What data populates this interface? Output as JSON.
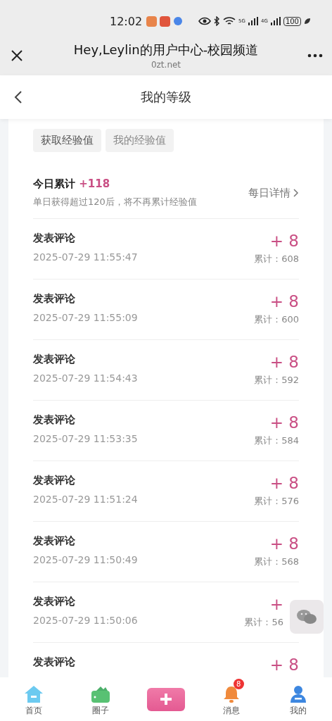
{
  "status_bar": {
    "time": "12:02",
    "network_1": "5G",
    "network_2": "4G",
    "battery": "100"
  },
  "browser": {
    "title": "Hey,Leylin的用户中心-校园频道",
    "domain": "0zt.net"
  },
  "page": {
    "title": "我的等级"
  },
  "tabs": [
    {
      "label": "获取经验值",
      "selected": true
    },
    {
      "label": "我的经验值",
      "selected": false
    }
  ],
  "today": {
    "label": "今日累计",
    "value": "+118",
    "note": "单日获得超过120后，将不再累计经验值",
    "link": "每日详情"
  },
  "records": [
    {
      "title": "发表评论",
      "time": "2025-07-29 11:55:47",
      "amount": "+ 8",
      "total": "累计：608"
    },
    {
      "title": "发表评论",
      "time": "2025-07-29 11:55:09",
      "amount": "+ 8",
      "total": "累计：600"
    },
    {
      "title": "发表评论",
      "time": "2025-07-29 11:54:43",
      "amount": "+ 8",
      "total": "累计：592"
    },
    {
      "title": "发表评论",
      "time": "2025-07-29 11:53:35",
      "amount": "+ 8",
      "total": "累计：584"
    },
    {
      "title": "发表评论",
      "time": "2025-07-29 11:51:24",
      "amount": "+ 8",
      "total": "累计：576"
    },
    {
      "title": "发表评论",
      "time": "2025-07-29 11:50:49",
      "amount": "+ 8",
      "total": "累计：568"
    },
    {
      "title": "发表评论",
      "time": "2025-07-29 11:50:06",
      "amount": "+",
      "total": "累计：56",
      "covered": true
    },
    {
      "title": "发表评论",
      "amount": "+ 8"
    }
  ],
  "nav": [
    {
      "kind": "home",
      "label": "首页"
    },
    {
      "kind": "circle",
      "label": "圈子"
    },
    {
      "kind": "add"
    },
    {
      "kind": "bell",
      "label": "消息",
      "badge": "8"
    },
    {
      "kind": "user",
      "label": "我的"
    }
  ]
}
